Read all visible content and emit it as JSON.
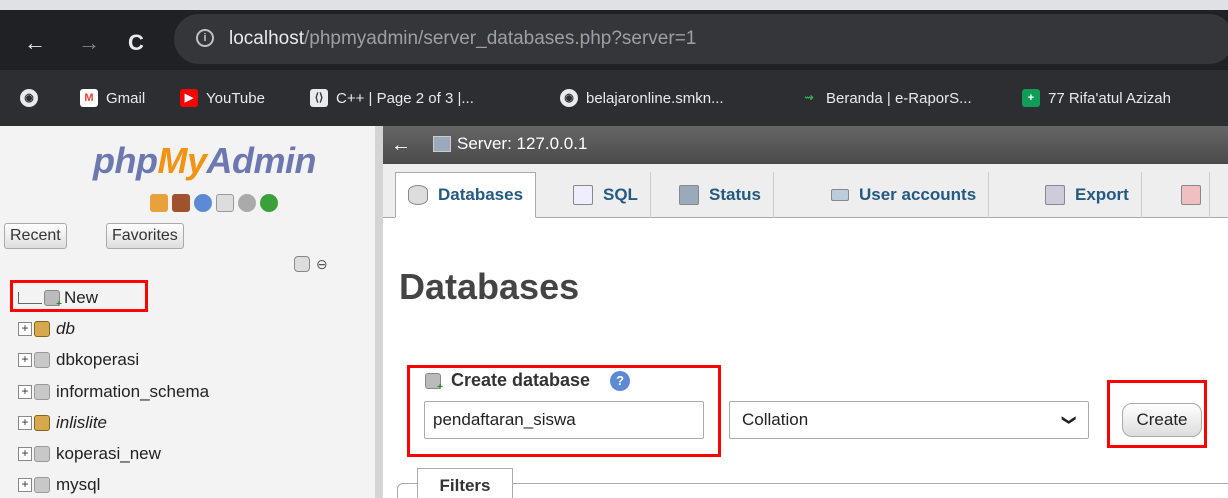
{
  "browser": {
    "url_prefix": "localhost",
    "url_rest": "/phpmyadmin/server_databases.php?server=1",
    "bookmarks": [
      {
        "label": "Gmail",
        "icon": "gmail-icon",
        "color": "#ea4335"
      },
      {
        "label": "YouTube",
        "icon": "youtube-icon",
        "color": "#ff0000"
      },
      {
        "label": "C++ | Page 2 of 3 |...",
        "icon": "code-icon",
        "color": "#5f6368"
      },
      {
        "label": "belajaronline.smkn...",
        "icon": "globe-icon",
        "color": "#5f6368"
      },
      {
        "label": "Beranda | e-RaporS...",
        "icon": "rapor-icon",
        "color": "#34a853"
      },
      {
        "label": "77 Rifa'atul Azizah",
        "icon": "plus-icon",
        "color": "#0f9d58"
      }
    ]
  },
  "sidebar": {
    "logo": {
      "php": "php",
      "my": "My",
      "admin": "Admin"
    },
    "recent_label": "Recent",
    "favorites_label": "Favorites",
    "tree": [
      {
        "label": "New",
        "kind": "new"
      },
      {
        "label": "db",
        "kind": "db-gold",
        "italic": true
      },
      {
        "label": "dbkoperasi",
        "kind": "db"
      },
      {
        "label": "information_schema",
        "kind": "db"
      },
      {
        "label": "inlislite",
        "kind": "db-gold",
        "italic": true
      },
      {
        "label": "koperasi_new",
        "kind": "db"
      },
      {
        "label": "mysql",
        "kind": "db"
      }
    ]
  },
  "main": {
    "server_label": "Server: 127.0.0.1",
    "tabs": [
      {
        "label": "Databases",
        "active": true
      },
      {
        "label": "SQL"
      },
      {
        "label": "Status"
      },
      {
        "label": "User accounts"
      },
      {
        "label": "Export"
      }
    ],
    "page_title": "Databases",
    "create_database_label": "Create database",
    "db_name_value": "pendaftaran_siswa",
    "collation_value": "Collation",
    "create_button": "Create",
    "filters_label": "Filters"
  }
}
